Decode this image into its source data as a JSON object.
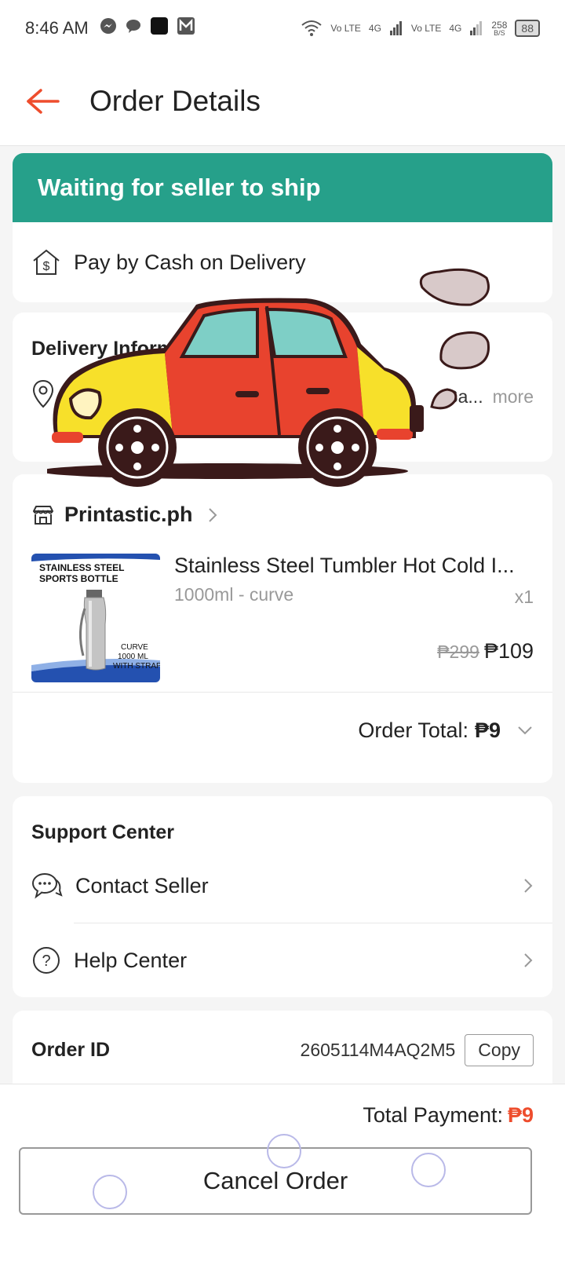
{
  "status_bar": {
    "time": "8:46 AM",
    "net_speed": "258",
    "net_unit": "B/S",
    "battery": "88",
    "sim1": "Vo LTE",
    "sim1_net": "4G",
    "sim2": "Vo LTE",
    "sim2_net": "4G"
  },
  "header": {
    "title": "Order Details"
  },
  "status": {
    "banner": "Waiting for seller to ship",
    "payment_method": "Pay by Cash on Delivery"
  },
  "delivery": {
    "title": "Delivery Inform",
    "address_visible": ", Sa...",
    "more": "more"
  },
  "shop": {
    "name": "Printastic.ph"
  },
  "product": {
    "name": "Stainless Steel Tumbler Hot Cold I...",
    "variation": "1000ml - curve",
    "quantity": "x1",
    "original_price": "₱299",
    "price": "₱109",
    "thumb_text_top": "STAINLESS STEEL SPORTS BOTTLE",
    "thumb_text_bottom": "CURVE 1000 ML WITH STRAP"
  },
  "order_total": {
    "label": "Order Total:",
    "amount": "₱9"
  },
  "support": {
    "title": "Support Center",
    "items": [
      {
        "label": "Contact Seller"
      },
      {
        "label": "Help Center"
      }
    ]
  },
  "order_id": {
    "label": "Order ID",
    "value": "2605114M4AQ2M5",
    "copy_label": "Copy"
  },
  "footer": {
    "total_label": "Total Payment:",
    "total_amount": "₱9",
    "cancel_label": "Cancel Order"
  },
  "colors": {
    "accent": "#ee4d2d",
    "banner": "#26a08a"
  }
}
